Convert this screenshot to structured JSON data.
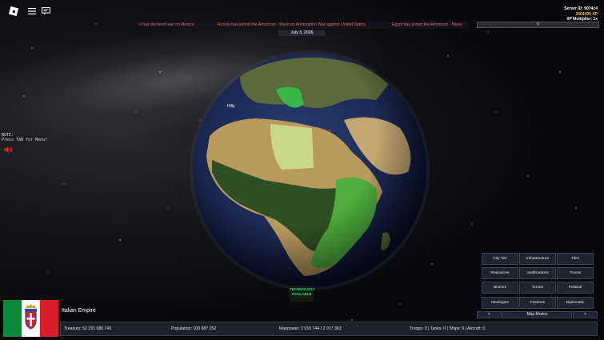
{
  "top_bar": {
    "server_id": "Server ID: 9074c4",
    "xp": "2664436 XP",
    "xp_multiplier": "XP Multiplier: 1x"
  },
  "news_ticker": [
    "s has declared war on Mexico",
    "Russia has joined the American - Mexican Annexation War against United States",
    "Egypt has joined the American - Mexic"
  ],
  "dropdown_label": "V",
  "date": "July 3, 2026",
  "note": {
    "line1": "NOTE:",
    "line2": "Press TAB for Menu!"
  },
  "map_label": "Hilly",
  "technology": {
    "line1": "TECHNOLOGY",
    "line2": "AVAILABLE"
  },
  "map_modes": [
    [
      "City Tier",
      "Infrastructure",
      "Tiles"
    ],
    [
      "Resources",
      "Justifications",
      "Truces"
    ],
    [
      "Biomes",
      "Terrain",
      "Political"
    ],
    [
      "Ideologies",
      "Factions",
      "Diplomatic"
    ]
  ],
  "map_nav": {
    "prev": "<",
    "label": "Map Modes",
    "next": ">"
  },
  "country": {
    "name": "Italian Empire",
    "flag_colors": [
      "#0b8a3a",
      "#ffffff",
      "#d81e2a"
    ]
  },
  "status_bar": {
    "treasury": "Treasury:  52 231 080 745",
    "population": "Population: 100 887 252",
    "manpower": "Manpower:  2 016 744  /  2 017 363",
    "military": "Troops: 0  |  Tanks: 0  |  Ships: 0  |  Aircraft: 0"
  }
}
